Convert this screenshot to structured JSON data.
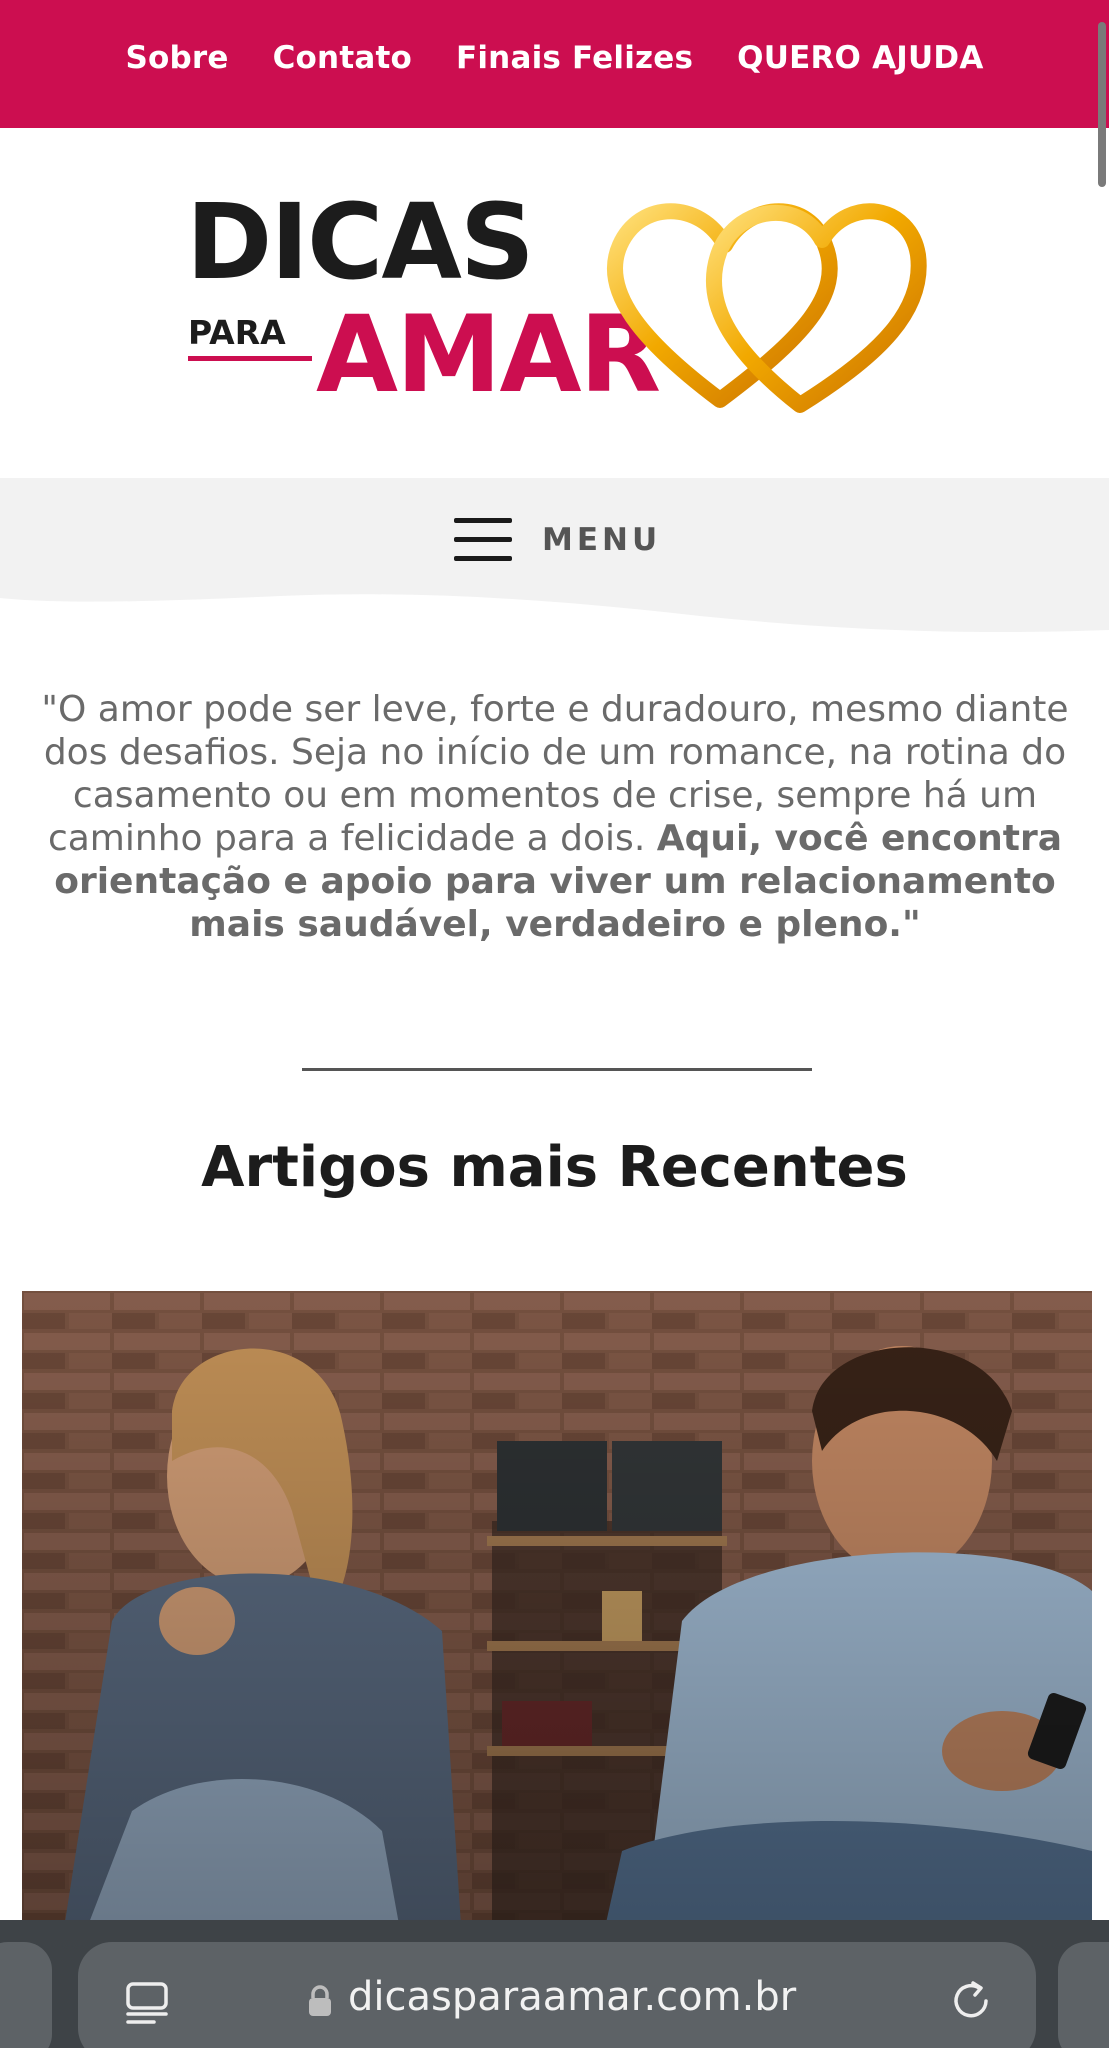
{
  "topnav": {
    "links": [
      "Sobre",
      "Contato",
      "Finais Felizes",
      "QUERO AJUDA"
    ],
    "background": "#cc0e50"
  },
  "logo": {
    "word1": "DICAS",
    "word2": "PARA",
    "word3": "AMAR",
    "accent": "#cc0e50",
    "hearts_color": "#f2a900"
  },
  "menu": {
    "label": "MENU"
  },
  "quote": {
    "normal": "\"O amor pode ser leve, forte e duradouro, mesmo diante dos desafios. Seja no início de um romance, na rotina do casamento ou em momentos de crise, sempre há um caminho para a felicidade a dois.",
    "bold": "Aqui, você encontra orientação e apoio para viver um relacionamento mais saudável, verdadeiro e pleno.\""
  },
  "section": {
    "title": "Artigos mais Recentes"
  },
  "browser": {
    "url": "dicasparaamar.com.br",
    "icons": [
      "tabs-icon",
      "lock-icon",
      "reload-icon"
    ]
  }
}
